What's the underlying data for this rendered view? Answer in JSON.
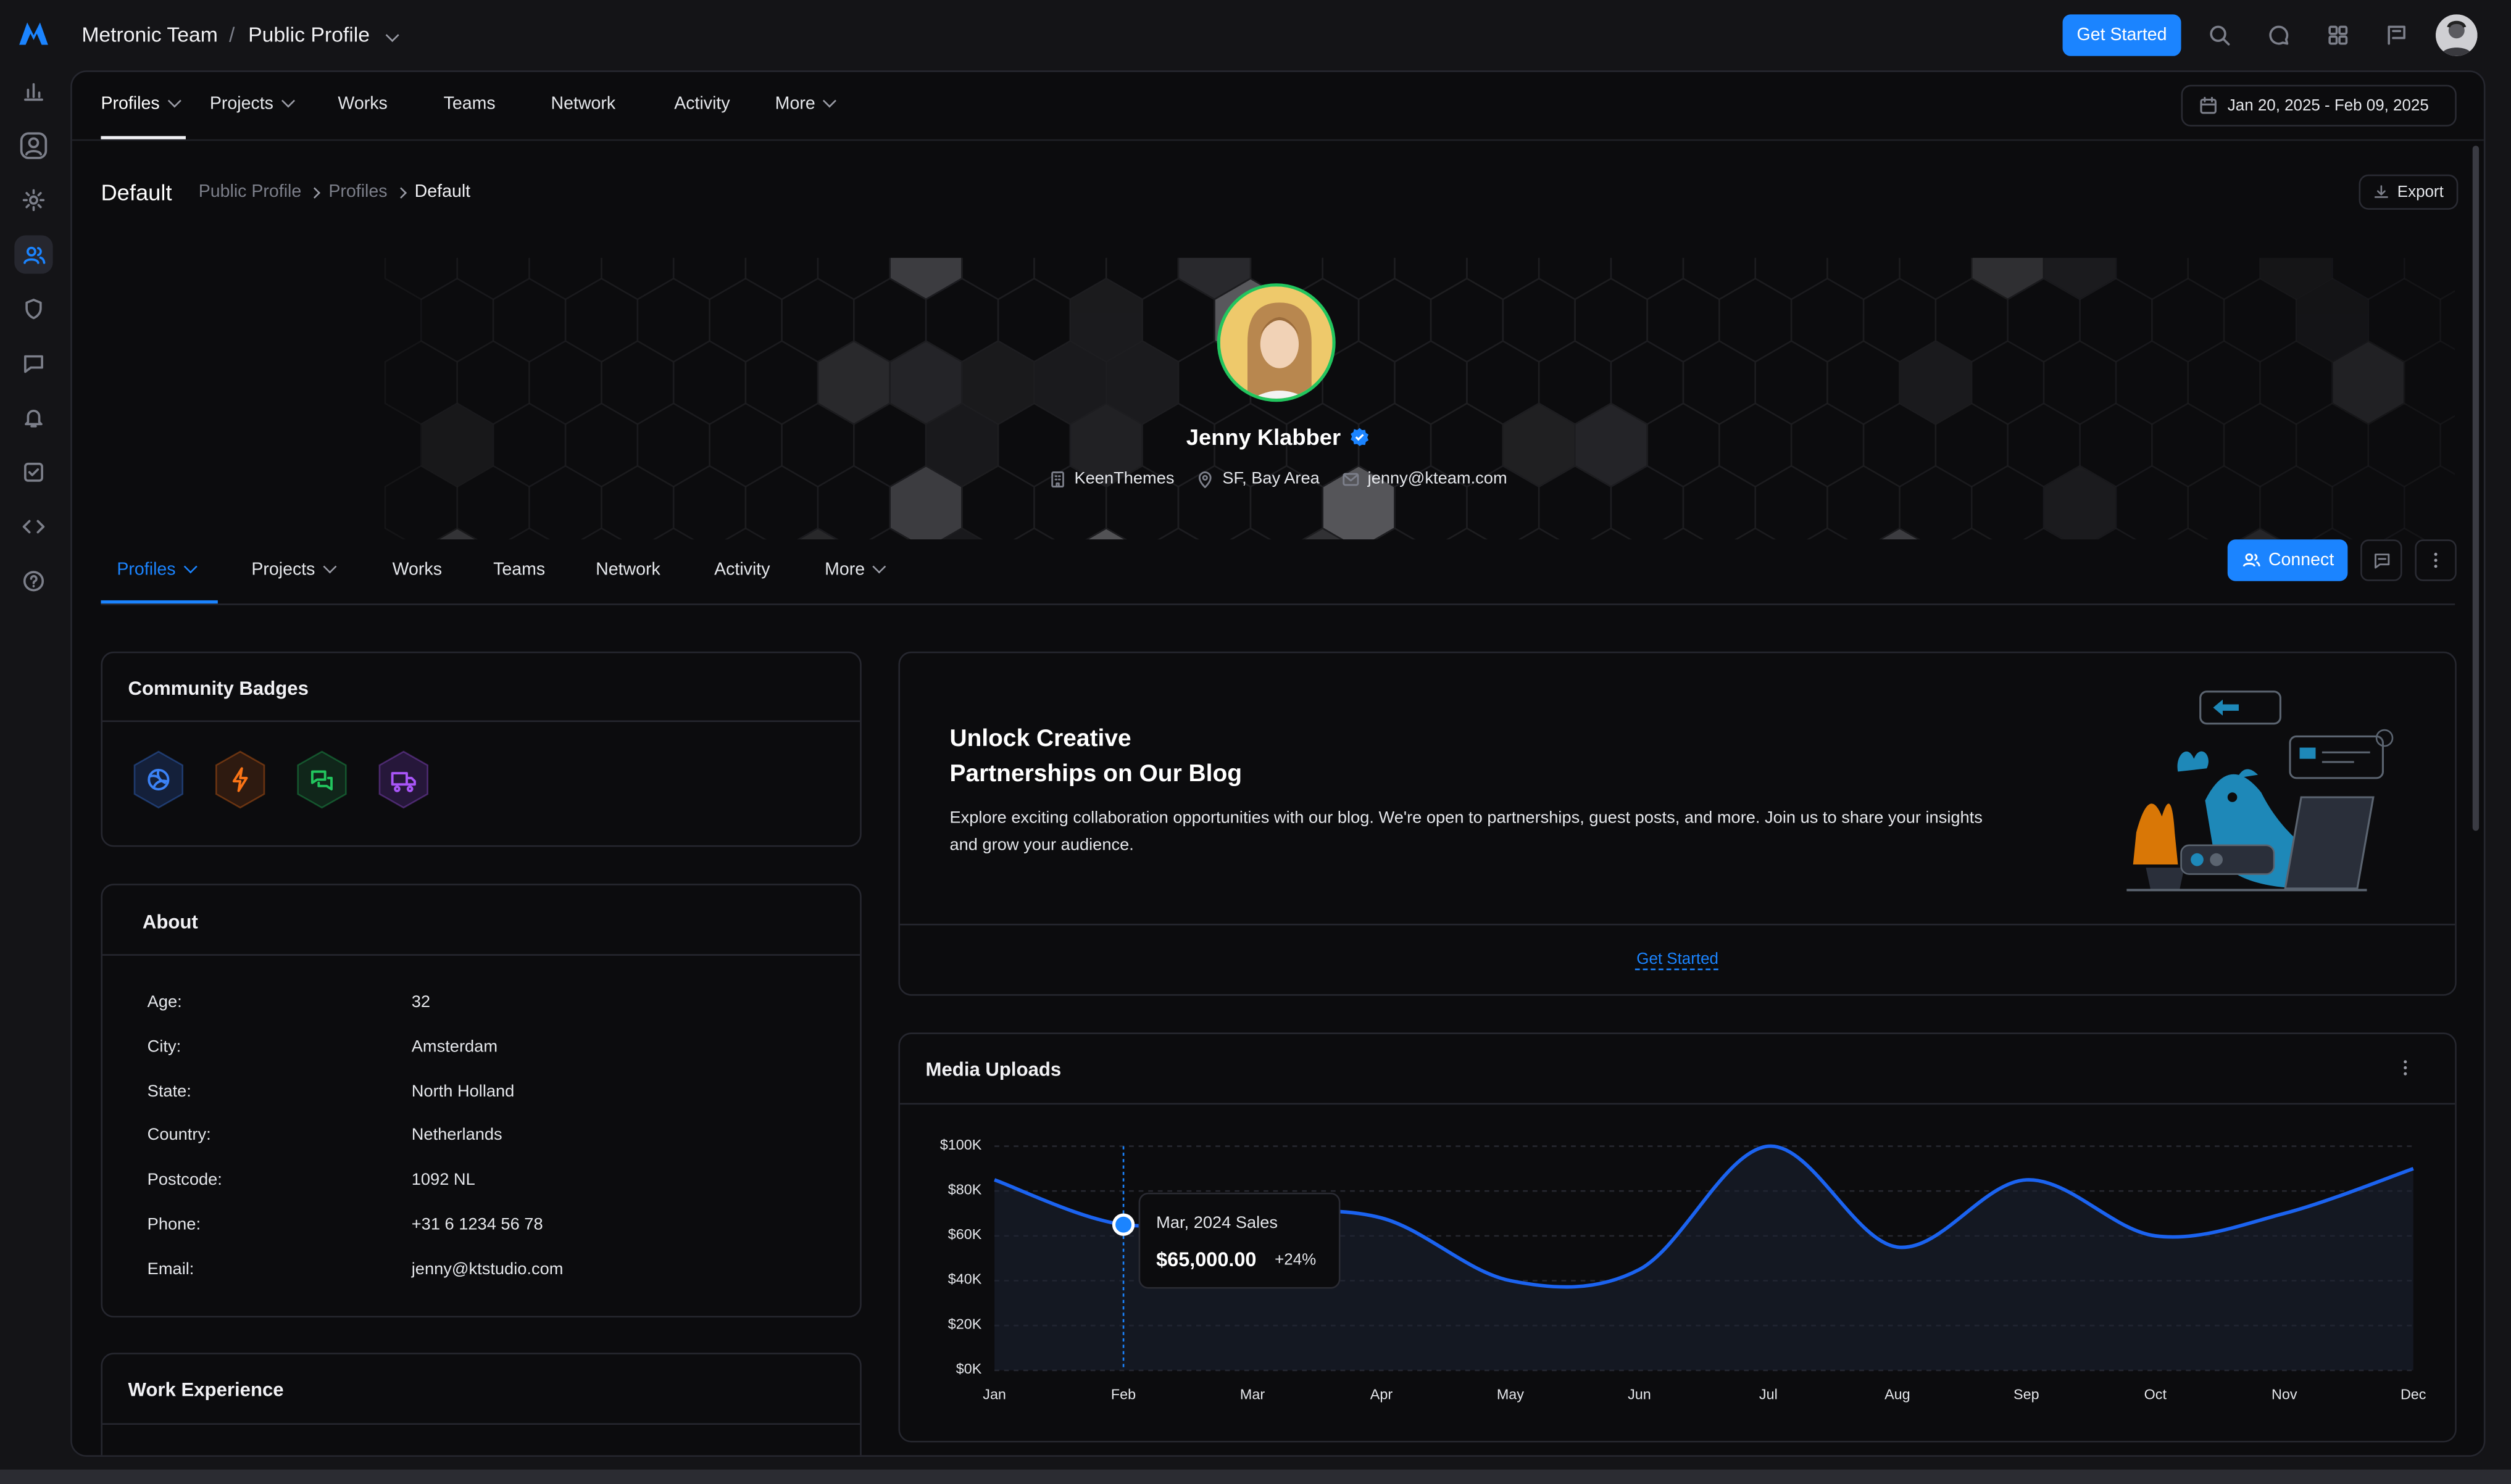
{
  "header": {
    "team": "Metronic Team",
    "separator": "/",
    "page": "Public Profile",
    "get_started": "Get Started"
  },
  "top_nav": {
    "items": [
      {
        "label": "Profiles",
        "active": true,
        "caret": true
      },
      {
        "label": "Projects",
        "caret": true
      },
      {
        "label": "Works"
      },
      {
        "label": "Teams"
      },
      {
        "label": "Network"
      },
      {
        "label": "Activity"
      },
      {
        "label": "More",
        "caret": true
      }
    ],
    "date_range": "Jan 20, 2025 - Feb 09, 2025"
  },
  "page_header": {
    "title": "Default",
    "breadcrumb": [
      "Public Profile",
      "Profiles",
      "Default"
    ],
    "export": "Export"
  },
  "profile": {
    "name": "Jenny Klabber",
    "company": "KeenThemes",
    "location": "SF, Bay Area",
    "email": "jenny@kteam.com"
  },
  "profile_tabs": {
    "items": [
      {
        "label": "Profiles",
        "active": true,
        "caret": true
      },
      {
        "label": "Projects",
        "caret": true
      },
      {
        "label": "Works"
      },
      {
        "label": "Teams"
      },
      {
        "label": "Network"
      },
      {
        "label": "Activity"
      },
      {
        "label": "More",
        "caret": true
      }
    ],
    "connect": "Connect"
  },
  "community_badges": {
    "title": "Community Badges",
    "badges": [
      {
        "icon": "volleyball-icon",
        "color": "#3b82f6",
        "bg": "#14203a"
      },
      {
        "icon": "lightning-icon",
        "color": "#f97316",
        "bg": "#2e1a10"
      },
      {
        "icon": "chat-bubbles-icon",
        "color": "#22c55e",
        "bg": "#10261a"
      },
      {
        "icon": "truck-icon",
        "color": "#a855f7",
        "bg": "#26173a"
      }
    ]
  },
  "about": {
    "title": "About",
    "rows": [
      {
        "label": "Age:",
        "value": "32"
      },
      {
        "label": "City:",
        "value": "Amsterdam"
      },
      {
        "label": "State:",
        "value": "North Holland"
      },
      {
        "label": "Country:",
        "value": "Netherlands"
      },
      {
        "label": "Postcode:",
        "value": "1092 NL"
      },
      {
        "label": "Phone:",
        "value": "+31 6 1234 56 78"
      },
      {
        "label": "Email:",
        "value": "jenny@ktstudio.com"
      }
    ]
  },
  "work_experience": {
    "title": "Work Experience"
  },
  "blog": {
    "title_line1": "Unlock Creative",
    "title_line2": "Partnerships on Our Blog",
    "body_line1": "Explore exciting collaboration opportunities with our blog. We're open to partnerships, guest posts, and more. Join us to share your insights",
    "body_line2": "and grow your audience.",
    "link": "Get Started"
  },
  "media_uploads": {
    "title": "Media Uploads",
    "tooltip": {
      "label": "Mar, 2024 Sales",
      "value": "$65,000.00",
      "change": "+24%"
    }
  },
  "colors": {
    "accent": "#1b84ff",
    "line": "#1b63f0"
  },
  "chart_data": {
    "type": "area",
    "x": [
      "Jan",
      "Feb",
      "Mar",
      "Apr",
      "May",
      "Jun",
      "Jul",
      "Aug",
      "Sep",
      "Oct",
      "Nov",
      "Dec"
    ],
    "y_ticks": [
      "$0K",
      "$20K",
      "$40K",
      "$60K",
      "$80K",
      "$100K"
    ],
    "ylim": [
      0,
      100000
    ],
    "series": [
      {
        "values": [
          85000,
          65000,
          70000,
          68000,
          40000,
          45000,
          100000,
          55000,
          85000,
          60000,
          70000,
          90000
        ]
      }
    ],
    "highlight_index": 1
  }
}
